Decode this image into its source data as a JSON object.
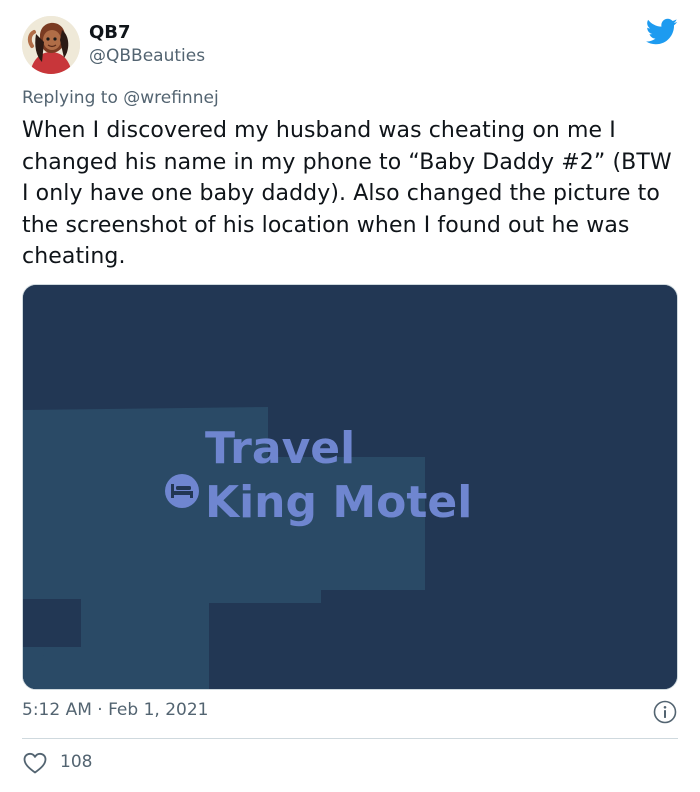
{
  "tweet": {
    "author": {
      "display_name": "QB7",
      "handle": "@QBBeauties"
    },
    "reply": {
      "prefix": "Replying to",
      "mention": "@wrefinnej"
    },
    "text": "When I discovered my husband was cheating on me I changed his name in my phone to “Baby Daddy #2” (BTW I only have one baby daddy). Also changed the picture to the screenshot of his location when I found out he was cheating.",
    "media": {
      "map_label_line1": "Travel",
      "map_label_line2": "King Motel",
      "pin_icon": "bed-icon"
    },
    "timestamp": "5:12 AM · Feb 1, 2021",
    "likes": "108"
  },
  "icons": {
    "brand": "twitter-bird-icon",
    "info": "info-icon",
    "like": "heart-icon"
  },
  "colors": {
    "twitter_blue": "#1d9bf0",
    "map_background": "#223754",
    "map_block": "#2a4a66",
    "map_label": "#6f86d0"
  }
}
